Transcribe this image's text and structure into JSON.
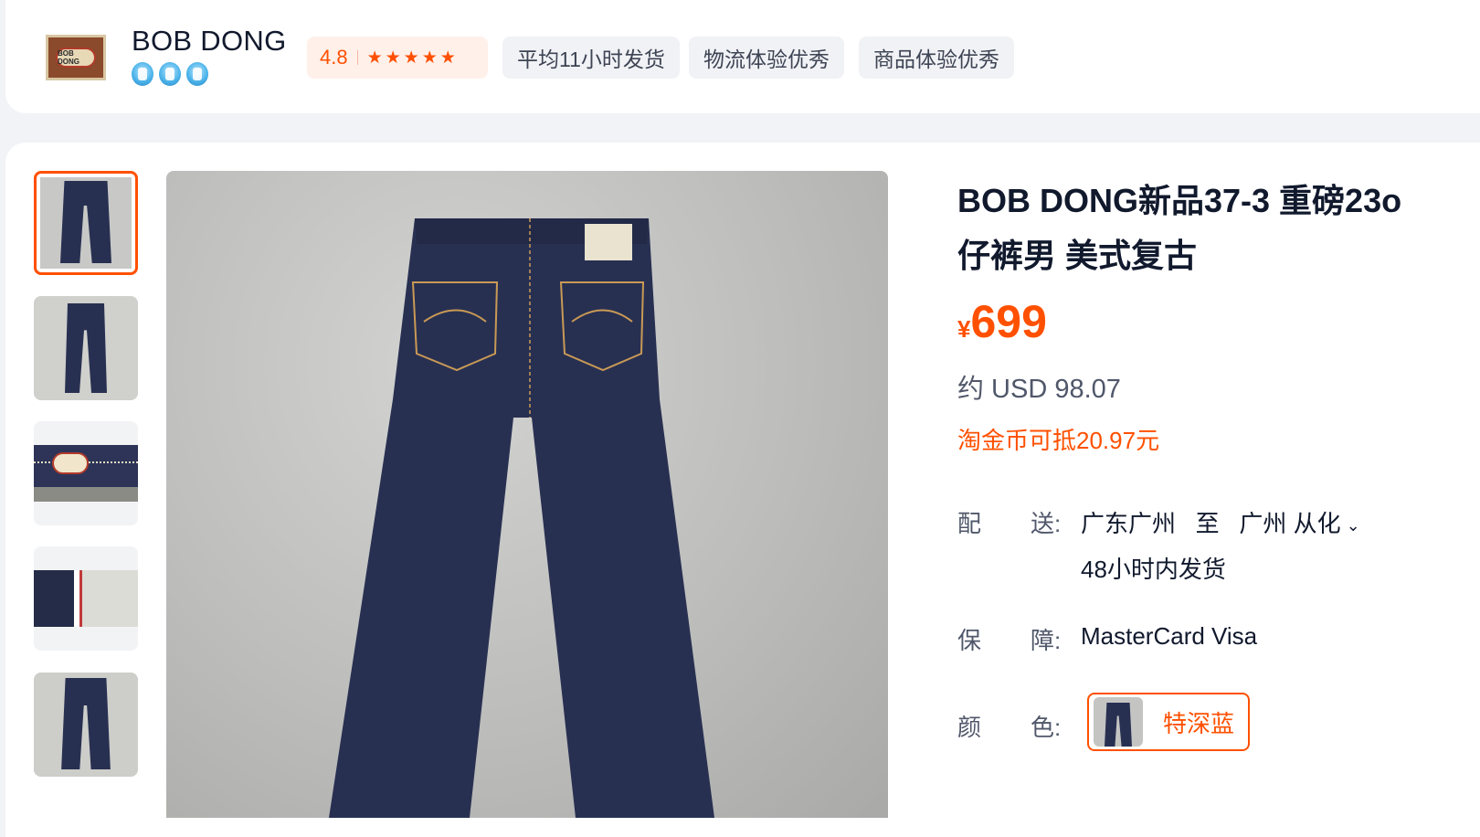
{
  "shop": {
    "name": "BOB DONG",
    "logo_text": "BOB DONG",
    "crown_icons": [
      "crown-icon",
      "crown-icon",
      "crown-icon"
    ],
    "rating": "4.8",
    "stars": "★★★★★",
    "tags": [
      "平均11小时发货",
      "物流体验优秀",
      "商品体验优秀"
    ]
  },
  "product": {
    "title_line1": "BOB DONG新品37-3 重磅23o",
    "title_line2": "仔裤男 美式复古",
    "currency_symbol": "¥",
    "price": "699",
    "usd": "约 USD 98.07",
    "coin_deduct": "淘金币可抵20.97元"
  },
  "delivery": {
    "label_a": "配",
    "label_b": "送:",
    "route": "广东广州   至   广州 从化",
    "route_chevron": "chevron-down-icon",
    "ship_time": "48小时内发货"
  },
  "guarantee": {
    "label_a": "保",
    "label_b": "障:",
    "value": "MasterCard Visa"
  },
  "color": {
    "label_a": "颜",
    "label_b": "色:",
    "selected": "特深蓝"
  },
  "colors": {
    "accent": "#ff5000",
    "denim": "#283052",
    "stitch": "#c99a55"
  }
}
